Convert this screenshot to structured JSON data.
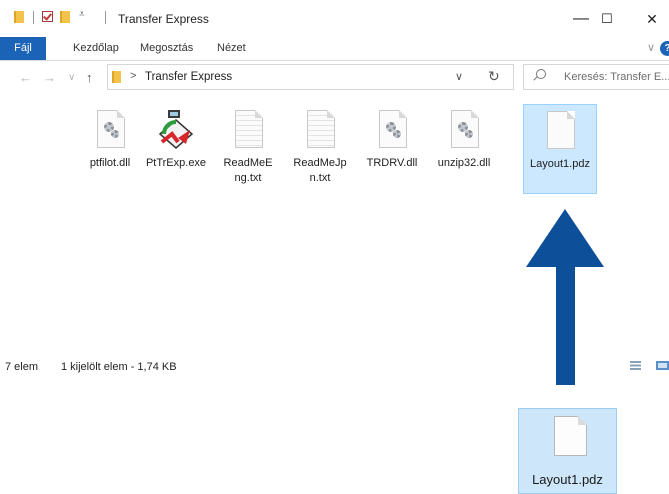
{
  "window": {
    "title": "Transfer Express",
    "controls": {
      "minimize": "—",
      "maximize": "☐",
      "close": "✕"
    }
  },
  "ribbon": {
    "file_tab": "Fájl",
    "tabs": [
      "Kezdőlap",
      "Megosztás",
      "Nézet"
    ],
    "help": "?",
    "collapse": "∨"
  },
  "address": {
    "path_separator": ">",
    "path": "Transfer Express",
    "dropdown": "∨",
    "refresh": "↻"
  },
  "search": {
    "placeholder": "Keresés: Transfer E..."
  },
  "nav": {
    "back": "←",
    "forward": "→",
    "recent": "∨",
    "up": "↑"
  },
  "files": [
    {
      "name": "ptfilot.dll",
      "icon": "dll-gear-icon",
      "selected": false
    },
    {
      "name": "PtTrExp.exe",
      "icon": "transfer-express-app-icon",
      "selected": false
    },
    {
      "name": "ReadMeEng.txt",
      "icon": "text-file-icon",
      "selected": false
    },
    {
      "name": "ReadMeJpn.txt",
      "icon": "text-file-icon",
      "selected": false
    },
    {
      "name": "TRDRV.dll",
      "icon": "dll-gear-icon",
      "selected": false
    },
    {
      "name": "unzip32.dll",
      "icon": "dll-gear-icon",
      "selected": false
    },
    {
      "name": "Layout1.pdz",
      "icon": "blank-file-icon",
      "selected": true
    }
  ],
  "status": {
    "count": "7 elem",
    "selection": "1 kijelölt elem - 1,74 KB"
  },
  "drag": {
    "name": "Layout1.pdz"
  },
  "colors": {
    "accent": "#1b63b7",
    "arrow": "#0d4f98",
    "selection": "#cce8ff"
  }
}
